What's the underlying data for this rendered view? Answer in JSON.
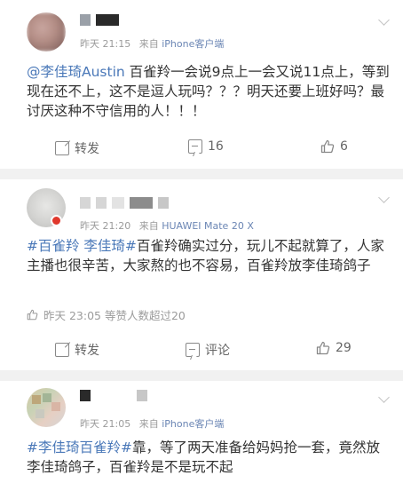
{
  "posts": [
    {
      "time": "昨天 21:15",
      "source_prefix": "来自",
      "source": "iPhone客户端",
      "mention": "@李佳琦Austin",
      "text": " 百雀羚一会说9点上一会又说11点上，等到现在还不上，这不是逗人玩吗？？？明天还要上班好吗？最讨厌这种不守信用的人！！！",
      "actions": {
        "forward": "转发",
        "comments": "16",
        "likes": "6"
      }
    },
    {
      "time": "昨天 21:20",
      "source_prefix": "来自",
      "source": "HUAWEI Mate 20 X",
      "tags": "#百雀羚 李佳琦#",
      "text": "百雀羚确实过分，玩儿不起就算了，人家主播也很辛苦，大家熬的也不容易，百雀羚放李佳琦鸽子",
      "like_note": "昨天 23:05 等赞人数超过20",
      "actions": {
        "forward": "转发",
        "comment": "评论",
        "likes": "29"
      }
    },
    {
      "time": "昨天 21:05",
      "source_prefix": "来自",
      "source": "iPhone客户端",
      "tags": "#李佳琦百雀羚#",
      "text": "靠，等了两天准备给妈妈抢一套，竟然放李佳琦鸽子，百雀羚是不是玩不起"
    }
  ],
  "colors": {
    "link": "#4a78b8",
    "meta": "#9b9b9b",
    "divider": "#f1f1f1"
  }
}
